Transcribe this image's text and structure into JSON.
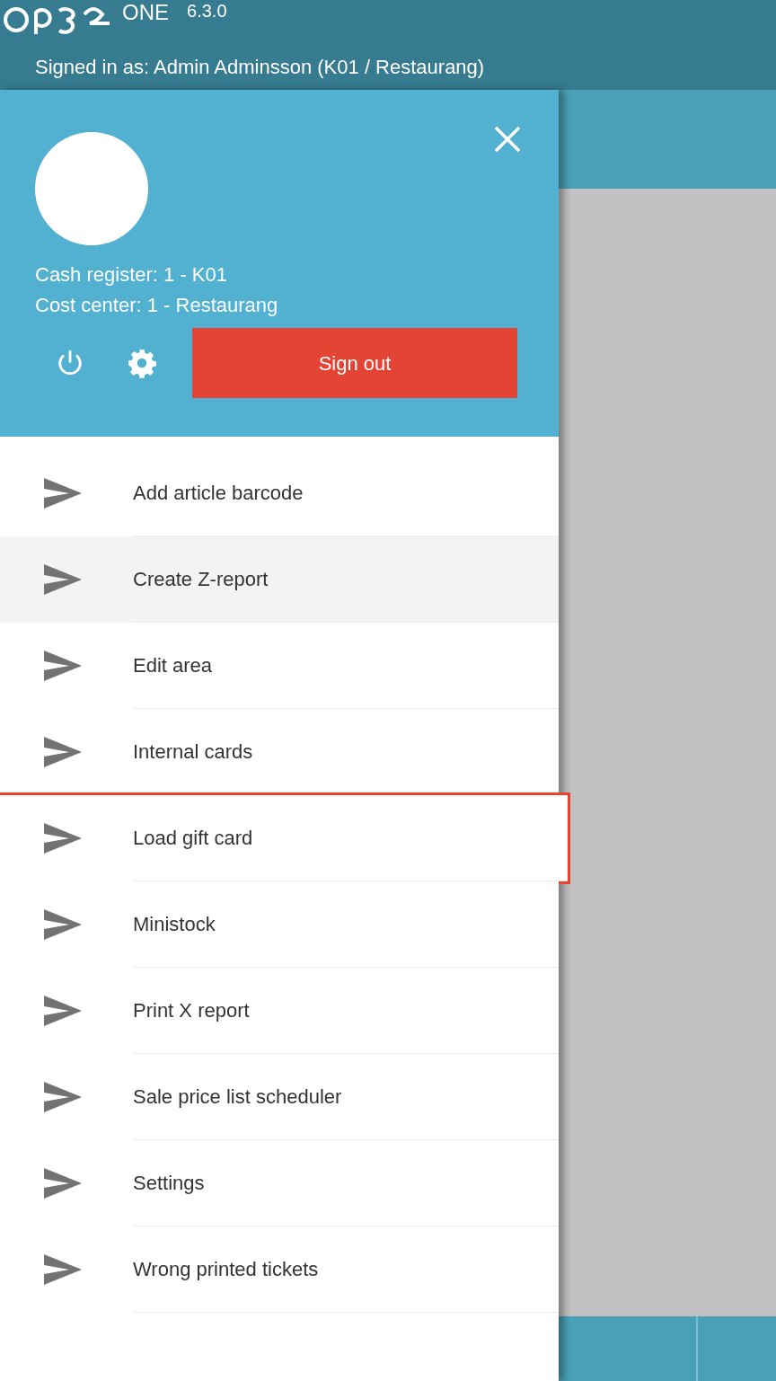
{
  "header": {
    "product": "ONE",
    "version": "6.3.0",
    "signed_in": "Signed in as: Admin Adminsson (K01 / Restaurang)"
  },
  "drawer": {
    "cash_register": "Cash register: 1 - K01",
    "cost_center": "Cost center: 1 - Restaurang",
    "sign_out": "Sign out"
  },
  "menu": [
    {
      "label": "Add article barcode",
      "selected": false,
      "outlined": false
    },
    {
      "label": "Create Z-report",
      "selected": true,
      "outlined": false
    },
    {
      "label": "Edit area",
      "selected": false,
      "outlined": false
    },
    {
      "label": "Internal cards",
      "selected": false,
      "outlined": false
    },
    {
      "label": "Load gift card",
      "selected": false,
      "outlined": true
    },
    {
      "label": "Ministock",
      "selected": false,
      "outlined": false
    },
    {
      "label": "Print X report",
      "selected": false,
      "outlined": false
    },
    {
      "label": "Sale price list scheduler",
      "selected": false,
      "outlined": false
    },
    {
      "label": "Settings",
      "selected": false,
      "outlined": false
    },
    {
      "label": "Wrong printed tickets",
      "selected": false,
      "outlined": false
    }
  ]
}
